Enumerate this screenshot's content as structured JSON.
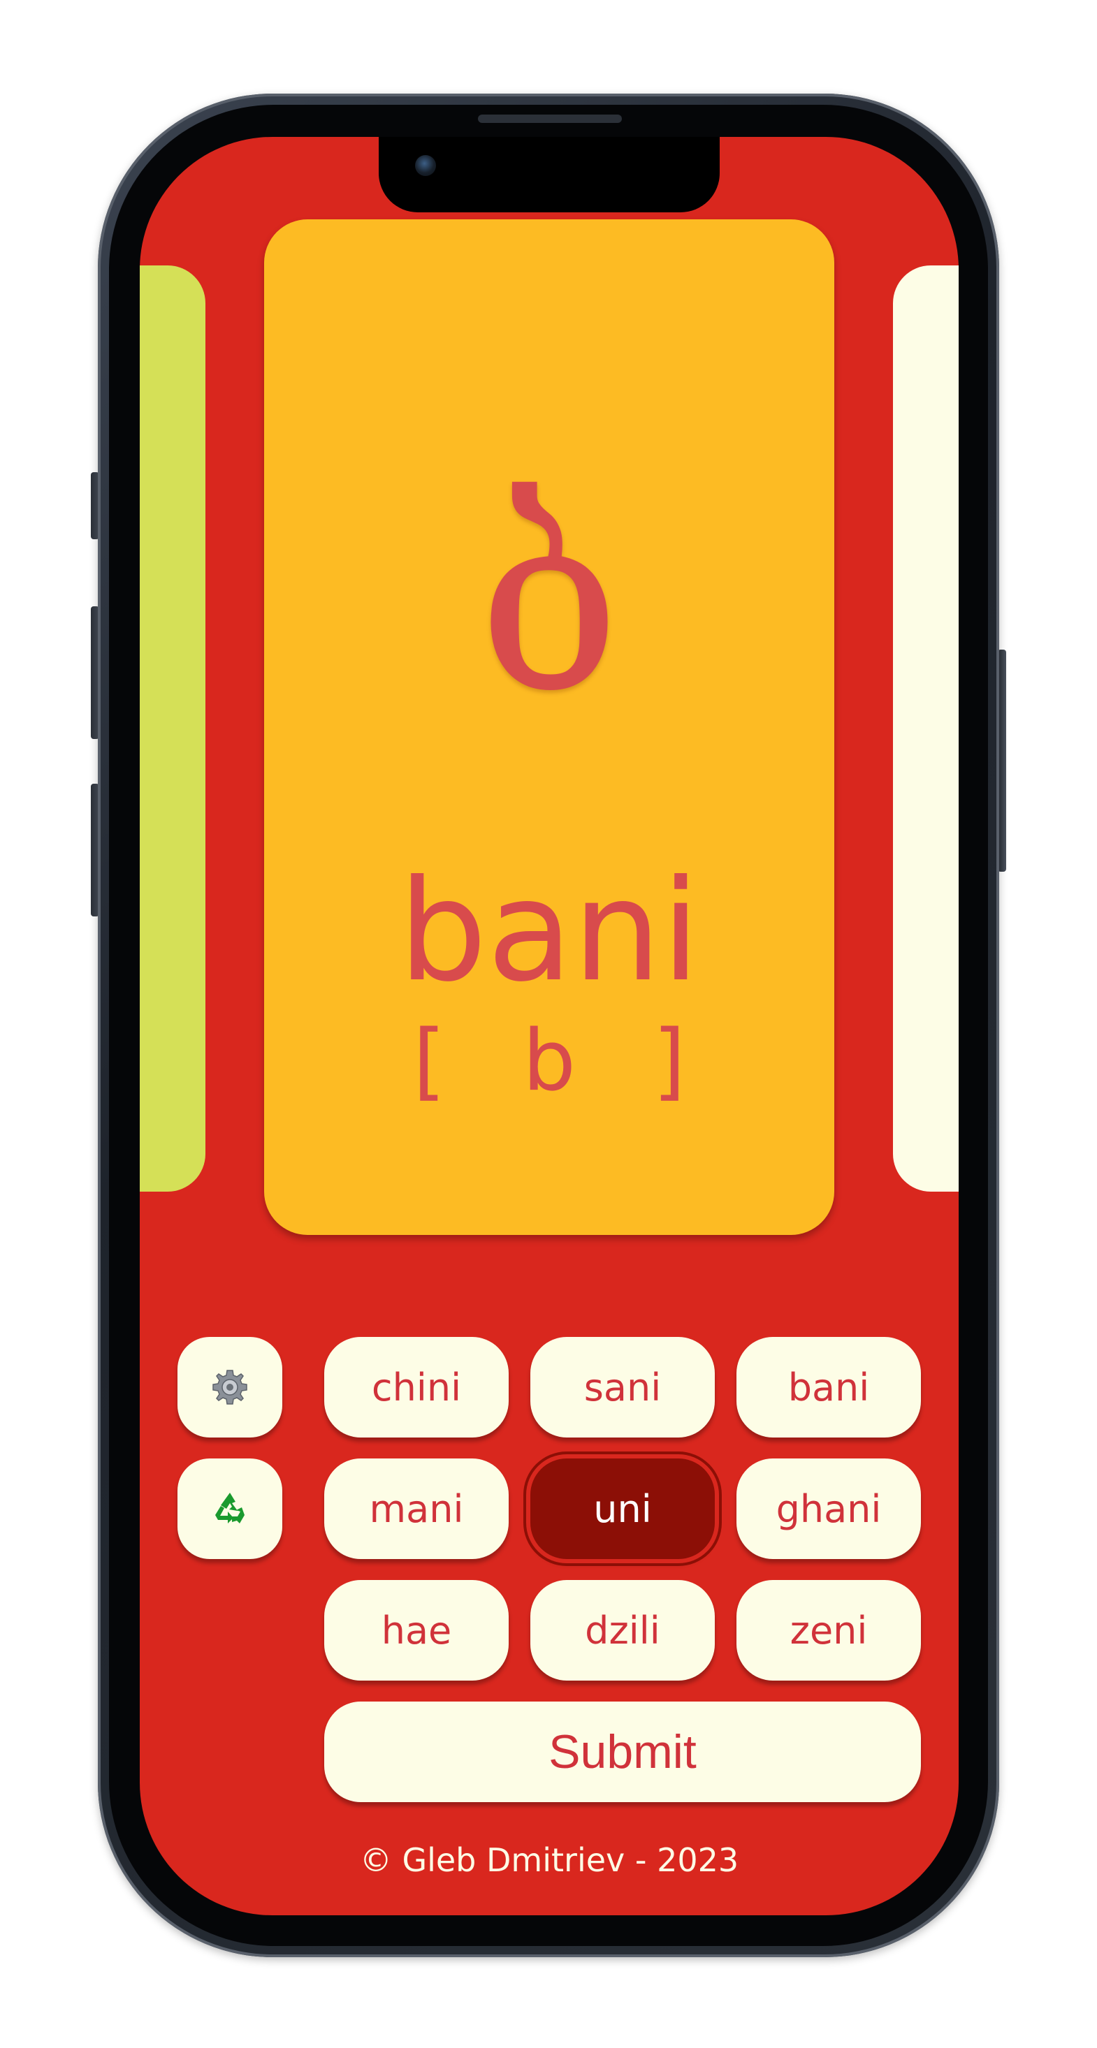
{
  "card": {
    "glyph": "ბ",
    "name": "bani",
    "ipa": "[ b ]"
  },
  "controls": {
    "settings_icon": "gear-icon",
    "reset_icon": "recycle-icon"
  },
  "options": [
    {
      "label": "chini",
      "selected": false
    },
    {
      "label": "sani",
      "selected": false
    },
    {
      "label": "bani",
      "selected": false
    },
    {
      "label": "mani",
      "selected": false
    },
    {
      "label": "uni",
      "selected": true
    },
    {
      "label": "ghani",
      "selected": false
    },
    {
      "label": "hae",
      "selected": false
    },
    {
      "label": "dzili",
      "selected": false
    },
    {
      "label": "zeni",
      "selected": false
    }
  ],
  "submit_label": "Submit",
  "footer": "© Gleb Dmitriev - 2023",
  "colors": {
    "background": "#d9271e",
    "card": "#fdbb23",
    "card_text": "#d84b4c",
    "left_peek_card": "#d5e057",
    "right_peek_card": "#fdfde6",
    "button": "#fdfde6",
    "button_text": "#d0323a",
    "selected_button": "#8c0f06"
  }
}
